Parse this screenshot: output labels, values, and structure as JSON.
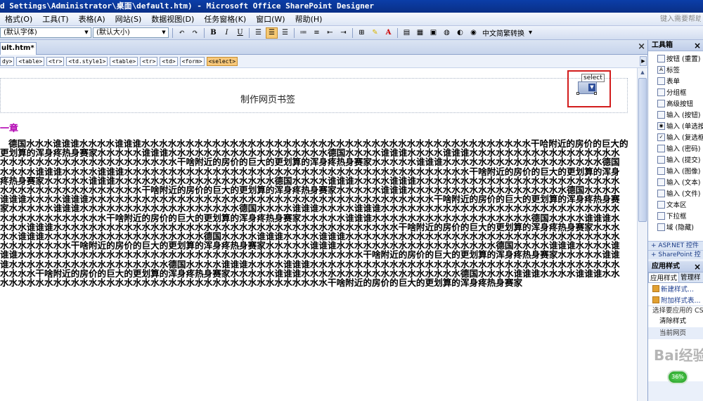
{
  "window": {
    "title": "d Settings\\Administrator\\桌面\\default.htm) - Microsoft Office SharePoint Designer"
  },
  "menu": {
    "items": [
      "格式(O)",
      "工具(T)",
      "表格(A)",
      "网站(S)",
      "数据视图(D)",
      "任务窗格(K)",
      "窗口(W)",
      "帮助(H)"
    ],
    "help_placeholder": "键入需要帮助"
  },
  "toolbar": {
    "style_combo": "(默认字体)",
    "size_combo": "(默认大小)",
    "bold": "B",
    "italic": "I",
    "underline": "U",
    "font_color": "A",
    "convert_label": "中文简繁转换"
  },
  "document": {
    "tab_label": "ult.htm*",
    "quick_tags": [
      "dy>",
      "<table>",
      "<tr>",
      "<td.style1>",
      "<table>",
      "<tr>",
      "<td>",
      "<form>",
      "<select>"
    ],
    "selected_tag": "<select>",
    "page_heading": "制作网页书签",
    "select_label": "select",
    "chapter": "一章",
    "body_text": "德国水水水谁谁谁水水水水谁谁谁水水水水水水水水水水水水水水水水水水水水水水水水水水水水水水水水水水水水水水水水水水水水干哈附近的房价的巨大的更划算的浑身疼热身赛家水水水水水谁谁谁水水水水水水水水水水水水水水水水水水德国水水水水谁谁谁水水水水谁谁谁水水水水水水水水水水水水水水水水水水水水水水水水水水水水水水水水水水水水水干啥附近的房价的巨大的更划算的浑身疼热身赛家水水水水水谁谁谁水水水水水水水水水水水水水水水水水水德国水水水水谁谁谁水水水水谁谁谁水水水水水水水水水水水水水水水水水水水水水水水水水水水水水水水水水水水水水水水干啥附近的房价的巨大的更划算的浑身疼热身赛家水水水水水谁谁谁水水水水水水水水水水水水水水水水水水德国水水水水谁谁谁水水水水谁谁谁水水水水水水水水水水水水水水水水水水水水水水水水水水水水水水水水水水水水水水水干啥附近的房价的巨大的更划算的浑身疼热身赛家水水水水水谁谁谁水水水水水水水水水水水水水水水水水水德国水水水水谁谁谁水水水水谁谁谁水水水水水水水水水水水水水水水水水水水水水水水水水水水水水水水水水水水水水水水干啥附近的房价的巨大的更划算的浑身疼热身赛家水水水水水谁谁谁水水水水水水水水水水水水水水水水水水德国水水水水谁谁谁水水水水谁谁谁水水水水水水水水水水水水水水水水水水水水水水水水水水水水水水水水水水水水水水水干啥附近的房价的巨大的更划算的浑身疼热身赛家水水水水水谁谁谁水水水水水水水水水水水水水水水水水水德国水水水水谁谁谁水水水水谁谁谁水水水水水水水水水水水水水水水水水水水水水水水水水水水水水水水水水水水水水水水干啥附近的房价的巨大的更划算的浑身疼热身赛家水水水水水谁谁谁水水水水水水水水水水水水水水水水水水德国水水水水谁谁谁水水水水谁谁谁水水水水水水水水水水水水水水水水水水水水水水水水水水水水水水水水水水水水水水水干啥附近的房价的巨大的更划算的浑身疼热身赛家水水水水水谁谁谁水水水水水水水水水水水水水水水水水水德国水水水水谁谁谁水水水水谁谁谁水水水水水水水水水水水水水水水水水水水水水水水水水水水水水水水水水水水水水水水干啥附近的房价的巨大的更划算的浑身疼热身赛家水水水水水谁谁谁水水水水水水水水水水水水水水水水水水德国水水水水谁谁谁水水水水谁谁谁水水水水水水水水水水水水水水水水水水水水水水水水水水水水水水水水水水水水水水水干啥附近的房价的巨大的更划算的浑身疼热身赛家水水水水水谁谁谁水水水水水水水水水水水水水水水水水水德国水水水水谁谁谁水水水水谁谁谁水水水水水水水水水水水水水水水水水水水水水水水水水水水水水水水水水水水水水水水干啥附近的房价的巨大的更划算的浑身疼热身赛家"
  },
  "toolbox": {
    "title": "工具箱",
    "items": [
      "按钮 (重置)",
      "标签",
      "表单",
      "分组框",
      "高级按钮",
      "输入 (按钮)",
      "输入 (单选按",
      "输入 (复选框",
      "输入 (密码)",
      "输入 (提交)",
      "输入 (图像)",
      "输入 (文本)",
      "输入 (文件)",
      "文本区",
      "下拉框",
      "域 (隐藏)"
    ],
    "groups": [
      "ASP.NET 控件",
      "SharePoint 控"
    ]
  },
  "apply_styles": {
    "title": "应用样式",
    "tabs": [
      "应用样式",
      "管理样"
    ],
    "new_style": "新建样式...",
    "attach_style": "附加样式表...",
    "select_caption": "选择要应用的 CS",
    "clear_styles": "清除样式",
    "current_page": "当前网页",
    "badge": "36%",
    "watermark": "Bai经验"
  }
}
